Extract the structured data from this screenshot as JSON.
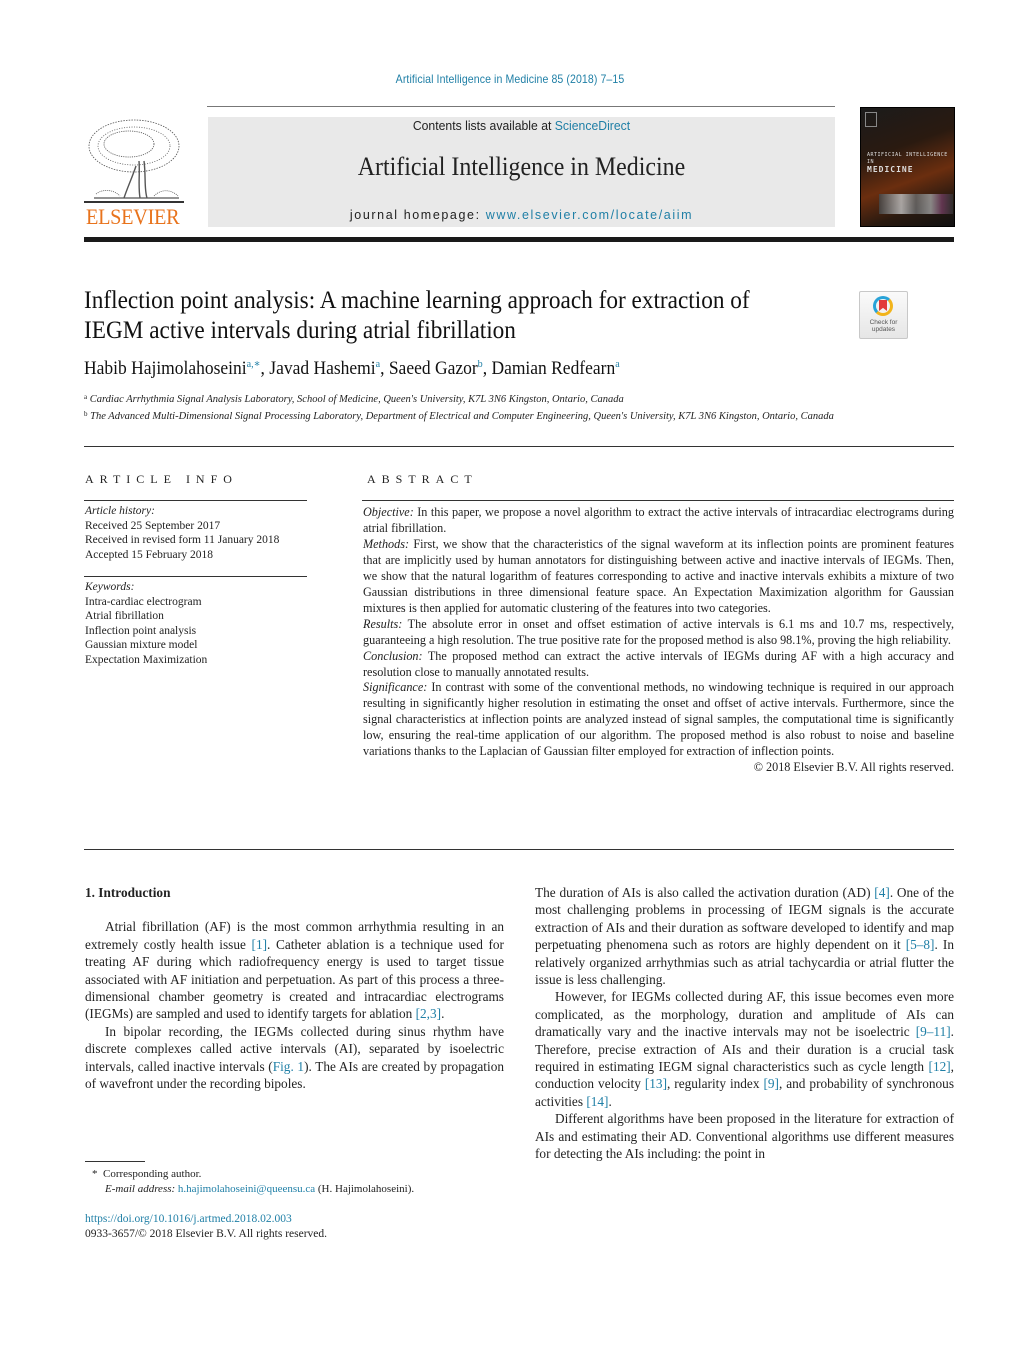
{
  "header": {
    "citation": "Artificial Intelligence in Medicine 85 (2018) 7–15",
    "publisher_logo_text": "ELSEVIER",
    "contents_prefix": "Contents lists available at ",
    "contents_link": "ScienceDirect",
    "journal_title": "Artificial Intelligence in Medicine",
    "homepage_prefix": "journal homepage: ",
    "homepage_link": "www.elsevier.com/locate/aiim",
    "cover_text_small": "ARTIFICIAL INTELLIGENCE IN",
    "cover_text_big": "MEDICINE",
    "check_updates_line1": "Check for",
    "check_updates_line2": "updates"
  },
  "article": {
    "title": "Inflection point analysis: A machine learning approach for extraction of IEGM active intervals during atrial fibrillation",
    "authors": [
      {
        "name": "Habib Hajimolahoseini",
        "sup": "a,∗"
      },
      {
        "name": "Javad Hashemi",
        "sup": "a"
      },
      {
        "name": "Saeed Gazor",
        "sup": "b"
      },
      {
        "name": "Damian Redfearn",
        "sup": "a"
      }
    ],
    "affiliations": [
      {
        "mark": "a",
        "text": "Cardiac Arrhythmia Signal Analysis Laboratory, School of Medicine, Queen's University, K7L 3N6 Kingston, Ontario, Canada"
      },
      {
        "mark": "b",
        "text": "The Advanced Multi-Dimensional Signal Processing Laboratory, Department of Electrical and Computer Engineering, Queen's University, K7L 3N6 Kingston, Ontario, Canada"
      }
    ]
  },
  "article_info": {
    "label": "ARTICLE INFO",
    "history_label": "Article history:",
    "history": [
      "Received 25 September 2017",
      "Received in revised form 11 January 2018",
      "Accepted 15 February 2018"
    ],
    "keywords_label": "Keywords:",
    "keywords": [
      "Intra-cardiac electrogram",
      "Atrial fibrillation",
      "Inflection point analysis",
      "Gaussian mixture model",
      "Expectation Maximization"
    ]
  },
  "abstract": {
    "label": "ABSTRACT",
    "sections": [
      {
        "head": "Objective:",
        "text": " In this paper, we propose a novel algorithm to extract the active intervals of intracardiac electrograms during atrial fibrillation."
      },
      {
        "head": "Methods:",
        "text": " First, we show that the characteristics of the signal waveform at its inflection points are prominent features that are implicitly used by human annotators for distinguishing between active and inactive intervals of IEGMs. Then, we show that the natural logarithm of features corresponding to active and inactive intervals exhibits a mixture of two Gaussian distributions in three dimensional feature space. An Expectation Maximization algorithm for Gaussian mixtures is then applied for automatic clustering of the features into two categories."
      },
      {
        "head": "Results:",
        "text": " The absolute error in onset and offset estimation of active intervals is 6.1 ms and 10.7 ms, respectively, guaranteeing a high resolution. The true positive rate for the proposed method is also 98.1%, proving the high reliability."
      },
      {
        "head": "Conclusion:",
        "text": " The proposed method can extract the active intervals of IEGMs during AF with a high accuracy and resolution close to manually annotated results."
      },
      {
        "head": "Significance:",
        "text": " In contrast with some of the conventional methods, no windowing technique is required in our approach resulting in significantly higher resolution in estimating the onset and offset of active intervals. Furthermore, since the signal characteristics at inflection points are analyzed instead of signal samples, the computational time is significantly low, ensuring the real-time application of our algorithm. The proposed method is also robust to noise and baseline variations thanks to the Laplacian of Gaussian filter employed for extraction of inflection points."
      }
    ],
    "copyright": "© 2018 Elsevier B.V. All rights reserved."
  },
  "body": {
    "section_heading": "1.  Introduction",
    "left_paragraphs": [
      [
        {
          "t": "Atrial fibrillation (AF) is the most common arrhythmia resulting in an extremely costly health issue "
        },
        {
          "t": "[1]",
          "link": true
        },
        {
          "t": ". Catheter ablation is a technique used for treating AF during which radiofrequency energy is used to target tissue associated with AF initiation and perpetuation. As part of this process a three-dimensional chamber geometry is created and intracardiac electrograms (IEGMs) are sampled and used to identify targets for ablation "
        },
        {
          "t": "[2,3]",
          "link": true
        },
        {
          "t": "."
        }
      ],
      [
        {
          "t": "In bipolar recording, the IEGMs collected during sinus rhythm have discrete complexes called active intervals (AI), separated by isoelectric intervals, called inactive intervals ("
        },
        {
          "t": "Fig. 1",
          "link": true
        },
        {
          "t": "). The AIs are created by propagation of wavefront under the recording bipoles."
        }
      ]
    ],
    "right_paragraphs": [
      [
        {
          "t": "The duration of AIs is also called the activation duration (AD) "
        },
        {
          "t": "[4]",
          "link": true
        },
        {
          "t": ". One of the most challenging problems in processing of IEGM signals is the accurate extraction of AIs and their duration as software developed to identify and map perpetuating phenomena such as rotors are highly dependent on it "
        },
        {
          "t": "[5–8]",
          "link": true
        },
        {
          "t": ". In relatively organized arrhythmias such as atrial tachycardia or atrial flutter the issue is less challenging."
        }
      ],
      [
        {
          "t": "However, for IEGMs collected during AF, this issue becomes even more complicated, as the morphology, duration and amplitude of AIs can dramatically vary and the inactive intervals may not be isoelectric "
        },
        {
          "t": "[9–11]",
          "link": true
        },
        {
          "t": ". Therefore, precise extraction of AIs and their duration is a crucial task required in estimating IEGM signal characteristics such as cycle length "
        },
        {
          "t": "[12]",
          "link": true
        },
        {
          "t": ", conduction velocity "
        },
        {
          "t": "[13]",
          "link": true
        },
        {
          "t": ", regularity index "
        },
        {
          "t": "[9]",
          "link": true
        },
        {
          "t": ", and probability of synchronous activities "
        },
        {
          "t": "[14]",
          "link": true
        },
        {
          "t": "."
        }
      ],
      [
        {
          "t": "Different algorithms have been proposed in the literature for extraction of AIs and estimating their AD. Conventional algorithms use different measures for detecting the AIs including: the point in"
        }
      ]
    ]
  },
  "footer": {
    "corresponding_mark": "*",
    "corresponding_label": "Corresponding author.",
    "email_label": "E-mail address:",
    "email": "h.hajimolahoseini@queensu.ca",
    "email_suffix": " (H. Hajimolahoseini).",
    "doi": "https://doi.org/10.1016/j.artmed.2018.02.003",
    "issn_line": "0933-3657/© 2018 Elsevier B.V. All rights reserved."
  },
  "colors": {
    "link": "#1f7fa6",
    "elsevier_orange": "#e8731c",
    "masthead_bg": "#e9e9e9"
  }
}
